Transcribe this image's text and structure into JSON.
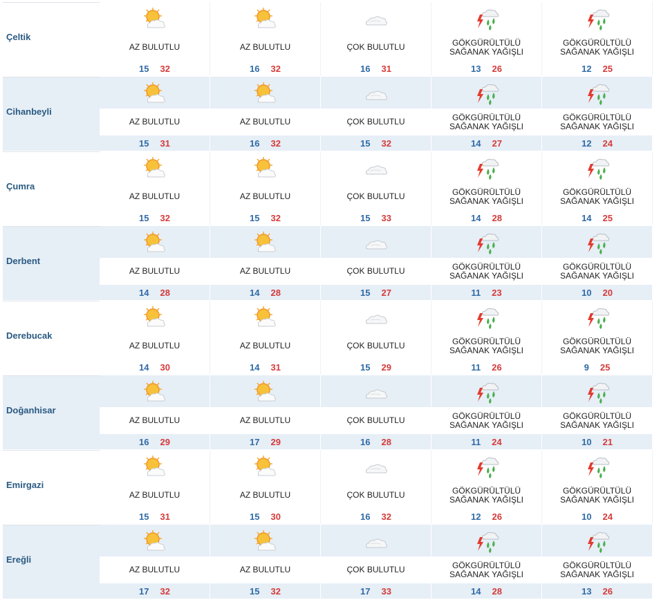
{
  "colors": {
    "row_alt_bg": "#e6eef6",
    "city": "#2a5a82",
    "min_temp": "#2f6aa6",
    "max_temp": "#d53a3a"
  },
  "rows": [
    {
      "city": "Çeltik",
      "days": [
        {
          "icon": "partly-cloudy-icon",
          "desc": "AZ BULUTLU",
          "min": "15",
          "max": "32"
        },
        {
          "icon": "partly-cloudy-icon",
          "desc": "AZ BULUTLU",
          "min": "16",
          "max": "32"
        },
        {
          "icon": "cloudy-icon",
          "desc": "ÇOK BULUTLU",
          "min": "16",
          "max": "31"
        },
        {
          "icon": "thunderstorm-icon",
          "desc": "GÖKGÜRÜLTÜLÜ SAĞANAK YAĞIŞLI",
          "min": "13",
          "max": "26"
        },
        {
          "icon": "thunderstorm-icon",
          "desc": "GÖKGÜRÜLTÜLÜ SAĞANAK YAĞIŞLI",
          "min": "12",
          "max": "25"
        }
      ]
    },
    {
      "city": "Cihanbeyli",
      "days": [
        {
          "icon": "partly-cloudy-icon",
          "desc": "AZ BULUTLU",
          "min": "15",
          "max": "31"
        },
        {
          "icon": "partly-cloudy-icon",
          "desc": "AZ BULUTLU",
          "min": "16",
          "max": "32"
        },
        {
          "icon": "cloudy-icon",
          "desc": "ÇOK BULUTLU",
          "min": "15",
          "max": "32"
        },
        {
          "icon": "thunderstorm-icon",
          "desc": "GÖKGÜRÜLTÜLÜ SAĞANAK YAĞIŞLI",
          "min": "14",
          "max": "27"
        },
        {
          "icon": "thunderstorm-icon",
          "desc": "GÖKGÜRÜLTÜLÜ SAĞANAK YAĞIŞLI",
          "min": "12",
          "max": "24"
        }
      ]
    },
    {
      "city": "Çumra",
      "days": [
        {
          "icon": "partly-cloudy-icon",
          "desc": "AZ BULUTLU",
          "min": "15",
          "max": "32"
        },
        {
          "icon": "partly-cloudy-icon",
          "desc": "AZ BULUTLU",
          "min": "15",
          "max": "32"
        },
        {
          "icon": "cloudy-icon",
          "desc": "ÇOK BULUTLU",
          "min": "15",
          "max": "33"
        },
        {
          "icon": "thunderstorm-icon",
          "desc": "GÖKGÜRÜLTÜLÜ SAĞANAK YAĞIŞLI",
          "min": "14",
          "max": "28"
        },
        {
          "icon": "thunderstorm-icon",
          "desc": "GÖKGÜRÜLTÜLÜ SAĞANAK YAĞIŞLI",
          "min": "14",
          "max": "25"
        }
      ]
    },
    {
      "city": "Derbent",
      "days": [
        {
          "icon": "partly-cloudy-icon",
          "desc": "AZ BULUTLU",
          "min": "14",
          "max": "28"
        },
        {
          "icon": "partly-cloudy-icon",
          "desc": "AZ BULUTLU",
          "min": "14",
          "max": "28"
        },
        {
          "icon": "cloudy-icon",
          "desc": "ÇOK BULUTLU",
          "min": "15",
          "max": "27"
        },
        {
          "icon": "thunderstorm-icon",
          "desc": "GÖKGÜRÜLTÜLÜ SAĞANAK YAĞIŞLI",
          "min": "11",
          "max": "23"
        },
        {
          "icon": "thunderstorm-icon",
          "desc": "GÖKGÜRÜLTÜLÜ SAĞANAK YAĞIŞLI",
          "min": "10",
          "max": "20"
        }
      ]
    },
    {
      "city": "Derebucak",
      "days": [
        {
          "icon": "partly-cloudy-icon",
          "desc": "AZ BULUTLU",
          "min": "14",
          "max": "30"
        },
        {
          "icon": "partly-cloudy-icon",
          "desc": "AZ BULUTLU",
          "min": "14",
          "max": "31"
        },
        {
          "icon": "cloudy-icon",
          "desc": "ÇOK BULUTLU",
          "min": "15",
          "max": "29"
        },
        {
          "icon": "thunderstorm-icon",
          "desc": "GÖKGÜRÜLTÜLÜ SAĞANAK YAĞIŞLI",
          "min": "11",
          "max": "26"
        },
        {
          "icon": "thunderstorm-icon",
          "desc": "GÖKGÜRÜLTÜLÜ SAĞANAK YAĞIŞLI",
          "min": "9",
          "max": "25"
        }
      ]
    },
    {
      "city": "Doğanhisar",
      "days": [
        {
          "icon": "partly-cloudy-icon",
          "desc": "AZ BULUTLU",
          "min": "16",
          "max": "29"
        },
        {
          "icon": "partly-cloudy-icon",
          "desc": "AZ BULUTLU",
          "min": "17",
          "max": "29"
        },
        {
          "icon": "cloudy-icon",
          "desc": "ÇOK BULUTLU",
          "min": "16",
          "max": "28"
        },
        {
          "icon": "thunderstorm-icon",
          "desc": "GÖKGÜRÜLTÜLÜ SAĞANAK YAĞIŞLI",
          "min": "11",
          "max": "24"
        },
        {
          "icon": "thunderstorm-icon",
          "desc": "GÖKGÜRÜLTÜLÜ SAĞANAK YAĞIŞLI",
          "min": "10",
          "max": "21"
        }
      ]
    },
    {
      "city": "Emirgazi",
      "days": [
        {
          "icon": "partly-cloudy-icon",
          "desc": "AZ BULUTLU",
          "min": "15",
          "max": "31"
        },
        {
          "icon": "partly-cloudy-icon",
          "desc": "AZ BULUTLU",
          "min": "15",
          "max": "30"
        },
        {
          "icon": "cloudy-icon",
          "desc": "ÇOK BULUTLU",
          "min": "16",
          "max": "32"
        },
        {
          "icon": "thunderstorm-icon",
          "desc": "GÖKGÜRÜLTÜLÜ SAĞANAK YAĞIŞLI",
          "min": "12",
          "max": "26"
        },
        {
          "icon": "thunderstorm-icon",
          "desc": "GÖKGÜRÜLTÜLÜ SAĞANAK YAĞIŞLI",
          "min": "10",
          "max": "24"
        }
      ]
    },
    {
      "city": "Ereğli",
      "days": [
        {
          "icon": "partly-cloudy-icon",
          "desc": "AZ BULUTLU",
          "min": "17",
          "max": "32"
        },
        {
          "icon": "partly-cloudy-icon",
          "desc": "AZ BULUTLU",
          "min": "15",
          "max": "32"
        },
        {
          "icon": "cloudy-icon",
          "desc": "ÇOK BULUTLU",
          "min": "17",
          "max": "33"
        },
        {
          "icon": "thunderstorm-icon",
          "desc": "GÖKGÜRÜLTÜLÜ SAĞANAK YAĞIŞLI",
          "min": "14",
          "max": "28"
        },
        {
          "icon": "thunderstorm-icon",
          "desc": "GÖKGÜRÜLTÜLÜ SAĞANAK YAĞIŞLI",
          "min": "13",
          "max": "26"
        }
      ]
    }
  ]
}
